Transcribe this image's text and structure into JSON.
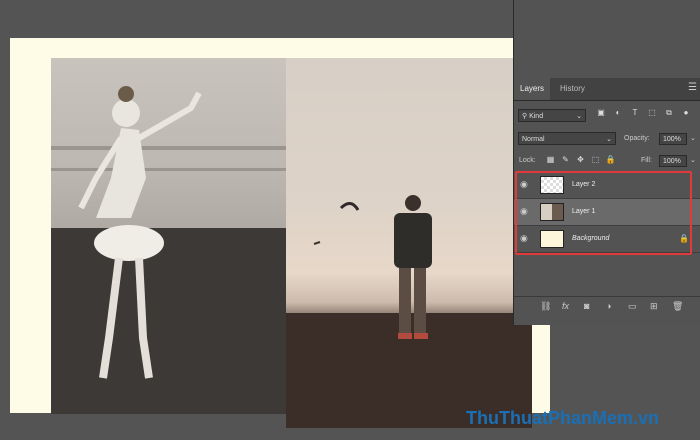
{
  "panel": {
    "tabs": [
      {
        "label": "Layers"
      },
      {
        "label": "History"
      }
    ],
    "filter": {
      "kind_label": "Kind"
    },
    "blend": {
      "mode": "Normal",
      "opacity_label": "Opacity:",
      "opacity_value": "100%"
    },
    "lock": {
      "label": "Lock:",
      "fill_label": "Fill:",
      "fill_value": "100%"
    },
    "layers": [
      {
        "name": "Layer 2",
        "visible": true,
        "selected": false,
        "thumbnail": "checkerboard-with-image"
      },
      {
        "name": "Layer 1",
        "visible": true,
        "selected": true,
        "thumbnail": "image"
      },
      {
        "name": "Background",
        "visible": true,
        "selected": false,
        "thumbnail": "cream-fill",
        "locked": true
      }
    ],
    "highlight_color": "#e03a3a"
  },
  "canvas": {
    "background_color": "#fefbe6"
  },
  "watermark": "ThuThuatPhanMem.vn"
}
